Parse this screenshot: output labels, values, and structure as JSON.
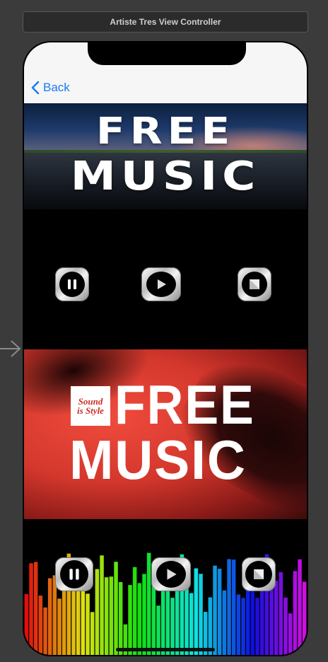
{
  "window": {
    "title": "Artiste Tres View Controller"
  },
  "navbar": {
    "back_label": "Back"
  },
  "banner_top": {
    "line1": "FREE",
    "line2": "MUSIC"
  },
  "banner_bottom": {
    "logo_line1": "Sound",
    "logo_line2": "is Style",
    "line1": "FREE",
    "line2": "MUSIC"
  },
  "controls": {
    "icons": [
      "pause-icon",
      "play-icon",
      "stop-icon"
    ]
  },
  "colors": {
    "accent": "#1a7cf2",
    "navbar_bg": "#f6f6f6",
    "canvas_bg": "#3b3b3b",
    "banner_red": "#d3372c"
  }
}
